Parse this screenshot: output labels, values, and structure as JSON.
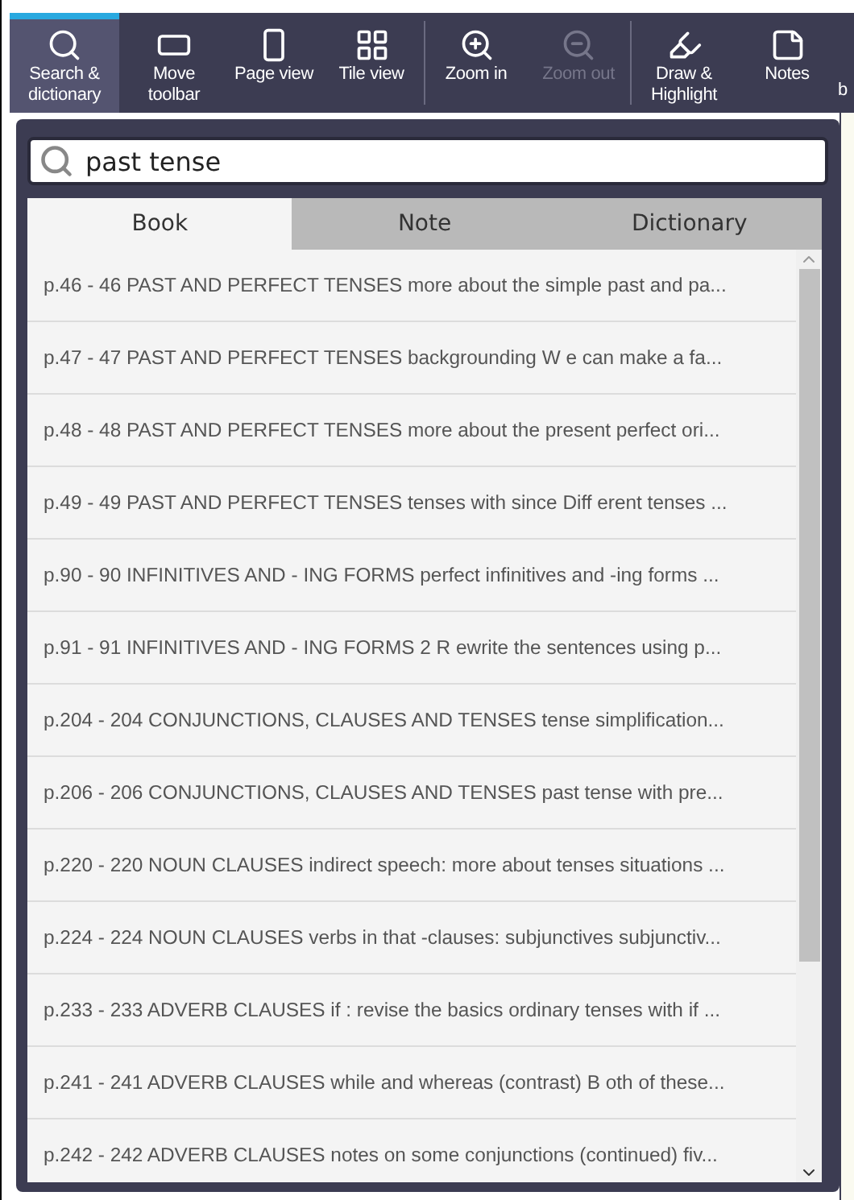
{
  "toolbar": {
    "groups": [
      {
        "items": [
          {
            "label": "Search &\ndictionary",
            "selected": true,
            "disabled": false
          },
          {
            "label": "Move\ntoolbar",
            "selected": false,
            "disabled": false
          },
          {
            "label": "Page view",
            "selected": false,
            "disabled": false
          },
          {
            "label": "Tile view",
            "selected": false,
            "disabled": false
          }
        ]
      },
      {
        "items": [
          {
            "label": "Zoom in",
            "selected": false,
            "disabled": false
          },
          {
            "label": "Zoom out",
            "selected": false,
            "disabled": true
          }
        ]
      },
      {
        "items": [
          {
            "label": "Draw &\nHighlight",
            "selected": false,
            "disabled": false
          },
          {
            "label": "Notes",
            "selected": false,
            "disabled": false
          },
          {
            "label": "b",
            "selected": false,
            "disabled": false
          }
        ]
      }
    ]
  },
  "search": {
    "value": "past tense"
  },
  "tabs": [
    {
      "label": "Book",
      "selected": true
    },
    {
      "label": "Note",
      "selected": false
    },
    {
      "label": "Dictionary",
      "selected": false
    }
  ],
  "results": [
    "p.46 - 46 PAST AND PERFECT TENSES more about the simple past and pa...",
    "p.47 - 47 PAST AND PERFECT TENSES backgrounding W e can make a fa...",
    "p.48 - 48 PAST AND PERFECT TENSES more about the present perfect ori...",
    "p.49 - 49 PAST AND PERFECT TENSES tenses with since Diff erent tenses ...",
    "p.90 - 90 INFINITIVES AND - ING FORMS perfect infinitives and -ing forms ...",
    "p.91 - 91 INFINITIVES AND - ING FORMS 2 R ewrite the sentences using p...",
    "p.204 - 204 CONJUNCTIONS, CLAUSES AND TENSES tense simplification...",
    "p.206 - 206 CONJUNCTIONS, CLAUSES AND TENSES past tense with pre...",
    "p.220 - 220 NOUN CLAUSES indirect speech: more about tenses situations ...",
    "p.224 - 224 NOUN CLAUSES verbs in that -clauses: subjunctives subjunctiv...",
    "p.233 - 233 ADVERB CLAUSES if : revise the basics ordinary tenses with if ...",
    "p.241 - 241 ADVERB CLAUSES while and whereas (contrast) B oth of these...",
    "p.242 - 242 ADVERB CLAUSES notes on some conjunctions (continued) fiv..."
  ]
}
